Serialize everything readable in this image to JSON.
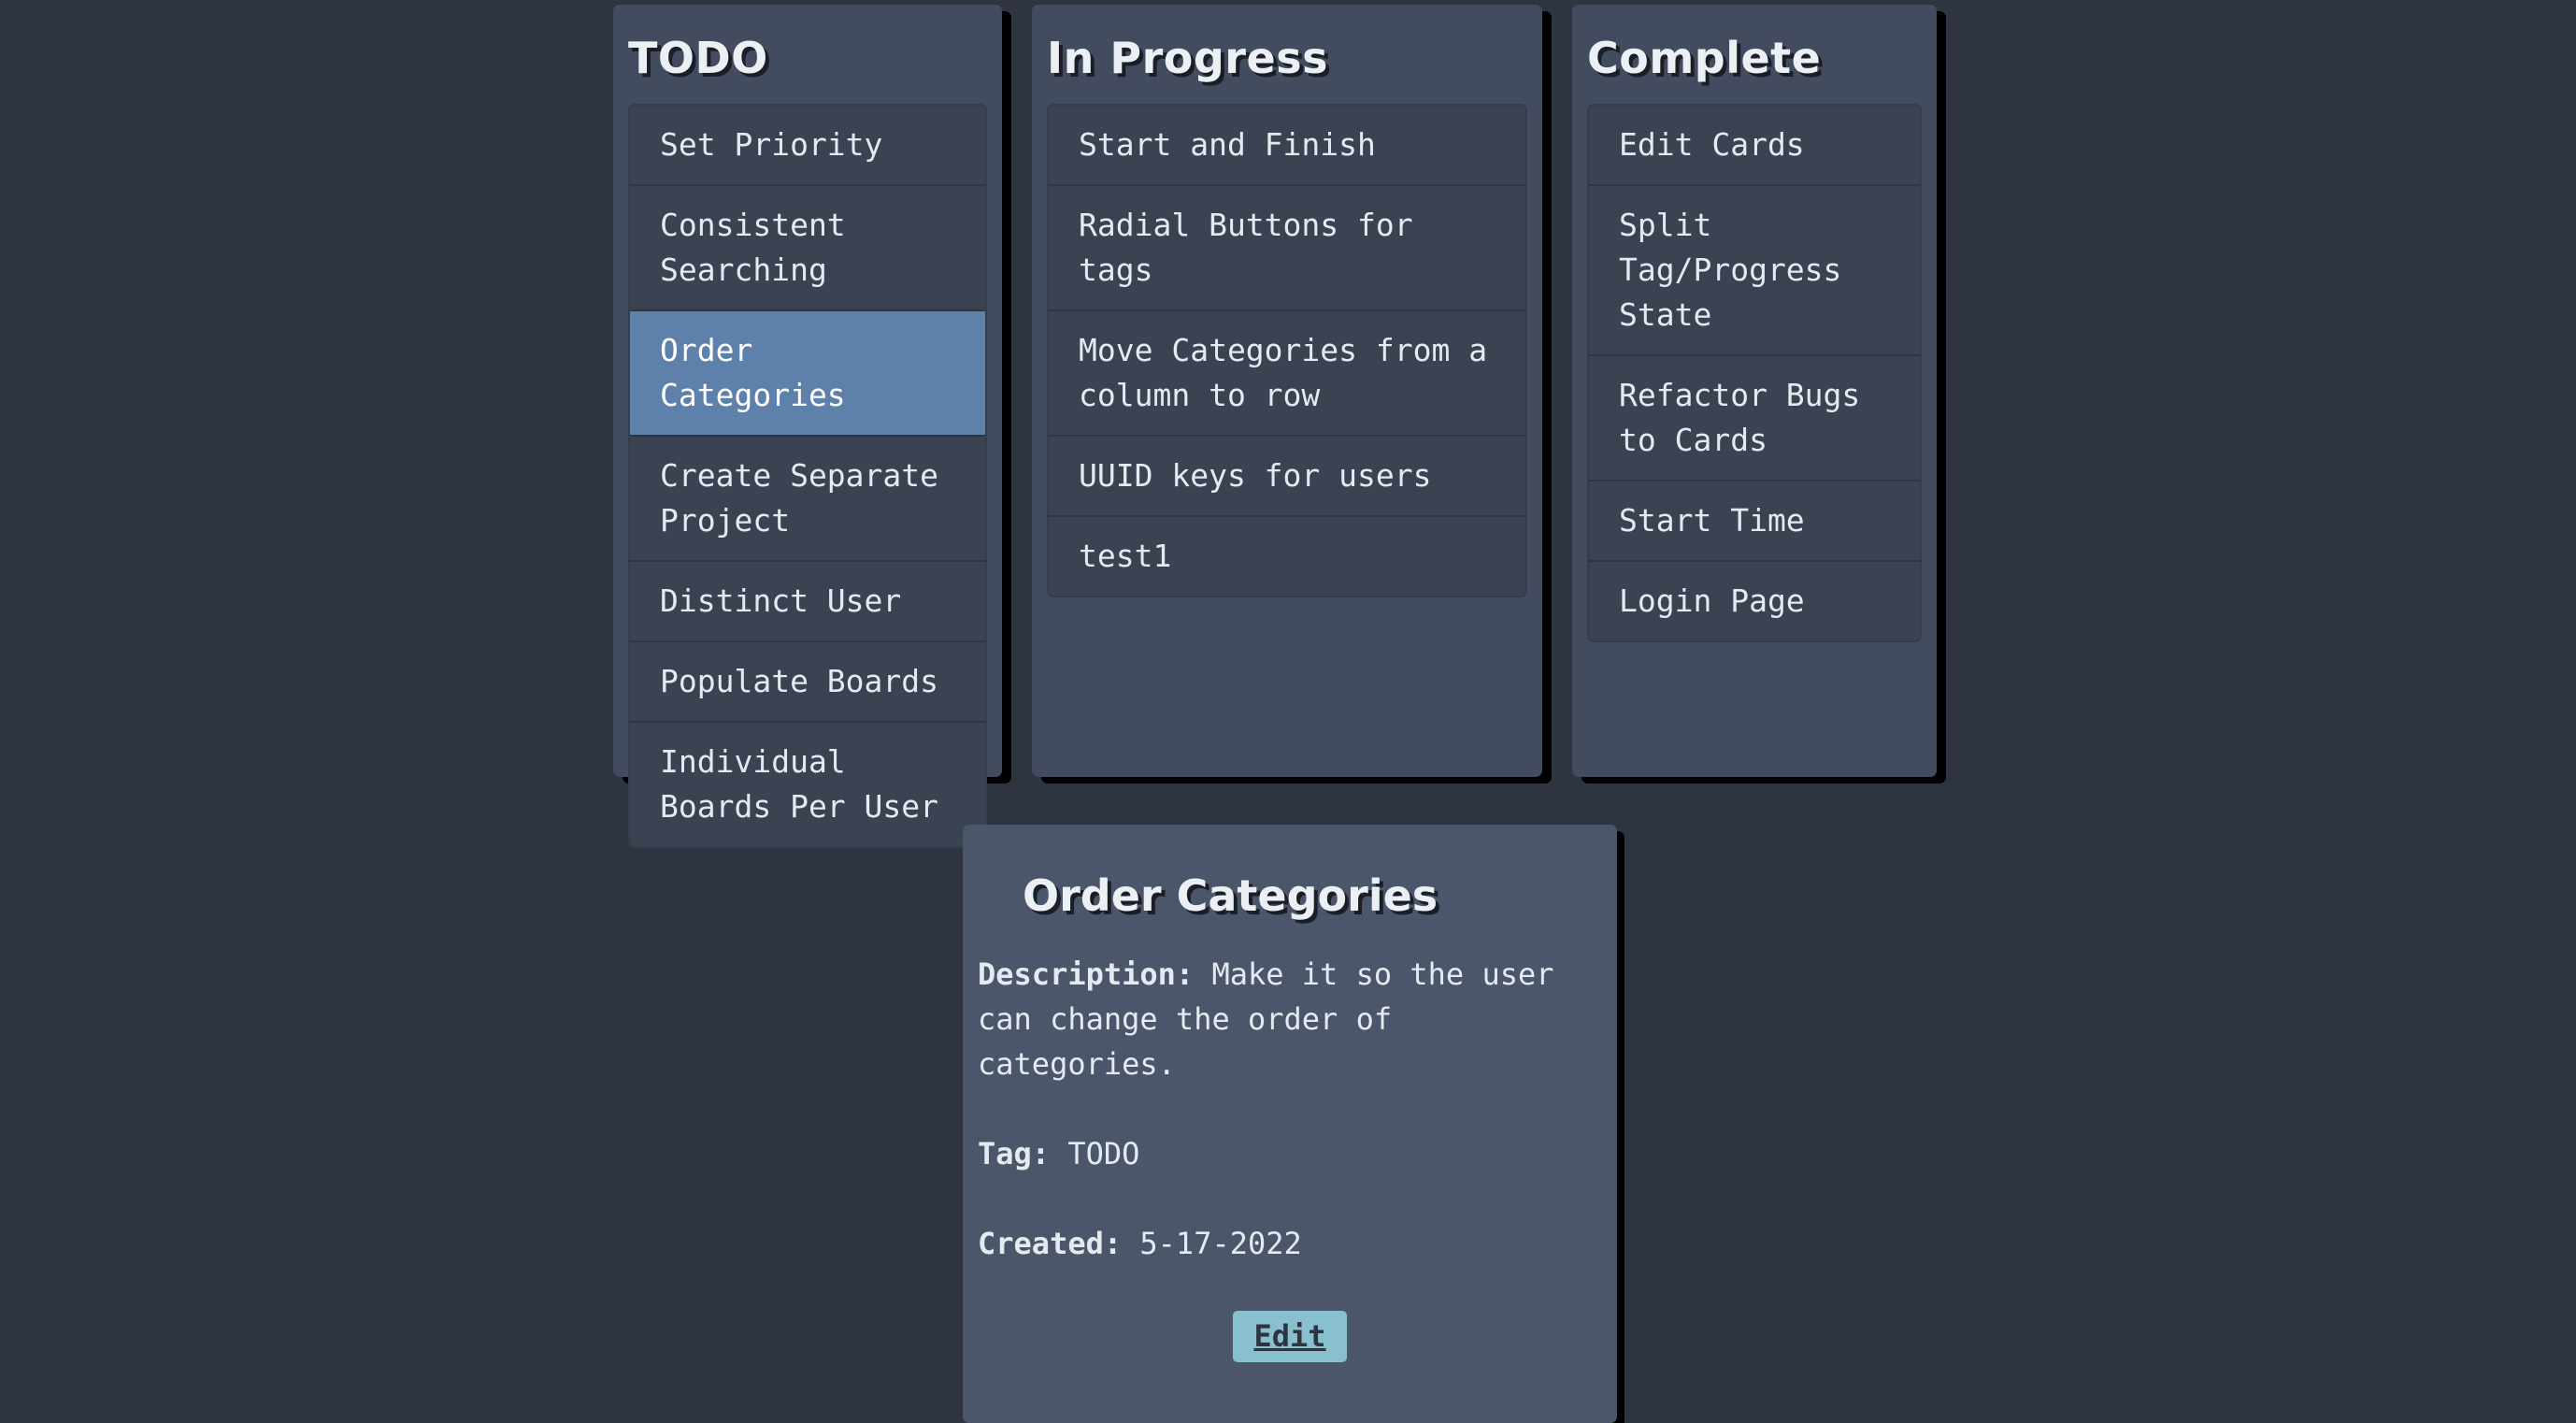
{
  "columns": [
    {
      "title": "TODO",
      "cards": [
        "Set Priority",
        "Consistent Searching",
        "Order Categories",
        "Create Separate Project",
        "Distinct User",
        "Populate Boards",
        "Individual Boards Per User"
      ]
    },
    {
      "title": "In Progress",
      "cards": [
        "Start and Finish",
        "Radial Buttons for tags",
        "Move Categories from a column to row",
        "UUID keys for users",
        "test1"
      ]
    },
    {
      "title": "Complete",
      "cards": [
        "Edit Cards",
        "Split Tag/Progress State",
        "Refactor Bugs to Cards",
        "Start Time",
        "Login Page"
      ]
    }
  ],
  "selected_card": "Order Categories",
  "detail": {
    "title": "Order Categories",
    "description_label": "Description:",
    "description": "Make it so the user can change the order of categories.",
    "tag_label": "Tag:",
    "tag": "TODO",
    "created_label": "Created:",
    "created": "5-17-2022",
    "edit_label": "Edit"
  },
  "colors": {
    "background": "#2e3440",
    "column": "#434c5e",
    "card": "#3b4252",
    "selected_card": "#5e81ac",
    "detail_panel": "#4c566a",
    "edit_button": "#88c0d0"
  }
}
